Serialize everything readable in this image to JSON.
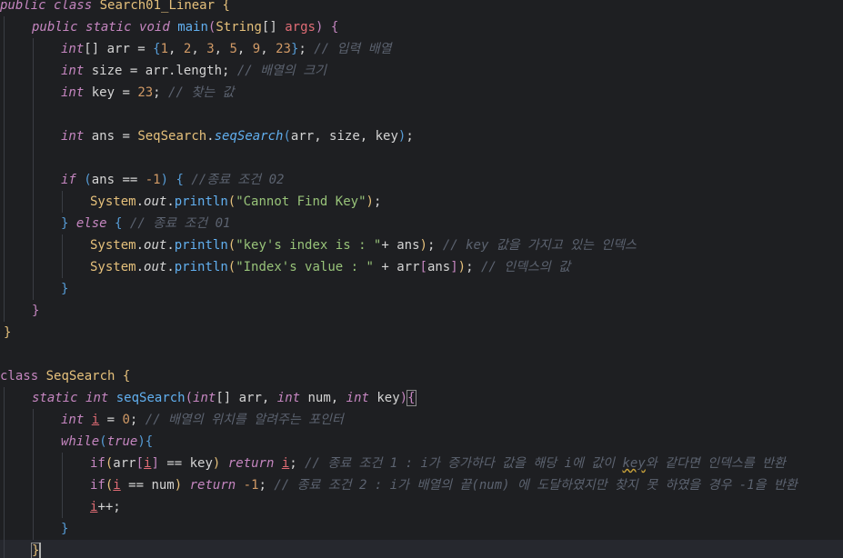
{
  "editor": {
    "lines": [
      {
        "segs": [
          [
            "kw",
            "public"
          ],
          [
            "plain",
            " "
          ],
          [
            "kw",
            "class"
          ],
          [
            "plain",
            " "
          ],
          [
            "cls",
            "Search01_Linear"
          ],
          [
            "plain",
            " "
          ],
          [
            "brace1",
            "{"
          ]
        ]
      },
      {
        "segs": [
          [
            "kw",
            "public"
          ],
          [
            "plain",
            " "
          ],
          [
            "kw",
            "static"
          ],
          [
            "plain",
            " "
          ],
          [
            "kw",
            "void"
          ],
          [
            "plain",
            " "
          ],
          [
            "fn",
            "main"
          ],
          [
            "brace2",
            "("
          ],
          [
            "cls",
            "String"
          ],
          [
            "plain",
            "[] "
          ],
          [
            "var",
            "args"
          ],
          [
            "brace2",
            ")"
          ],
          [
            "plain",
            " "
          ],
          [
            "brace2",
            "{"
          ]
        ]
      },
      {
        "segs": [
          [
            "type",
            "int"
          ],
          [
            "plain",
            "[] arr = "
          ],
          [
            "brace3",
            "{"
          ],
          [
            "num",
            "1"
          ],
          [
            "plain",
            ", "
          ],
          [
            "num",
            "2"
          ],
          [
            "plain",
            ", "
          ],
          [
            "num",
            "3"
          ],
          [
            "plain",
            ", "
          ],
          [
            "num",
            "5"
          ],
          [
            "plain",
            ", "
          ],
          [
            "num",
            "9"
          ],
          [
            "plain",
            ", "
          ],
          [
            "num",
            "23"
          ],
          [
            "brace3",
            "}"
          ],
          [
            "plain",
            "; "
          ],
          [
            "cmt",
            "// 입력 배열"
          ]
        ]
      },
      {
        "segs": [
          [
            "type",
            "int"
          ],
          [
            "plain",
            " size = arr.length; "
          ],
          [
            "cmt",
            "// 배열의 크기"
          ]
        ]
      },
      {
        "segs": [
          [
            "type",
            "int"
          ],
          [
            "plain",
            " key = "
          ],
          [
            "num",
            "23"
          ],
          [
            "plain",
            "; "
          ],
          [
            "cmt",
            "// 찾는 값"
          ]
        ]
      },
      {
        "segs": []
      },
      {
        "segs": [
          [
            "type",
            "int"
          ],
          [
            "plain",
            " ans = "
          ],
          [
            "cls",
            "SeqSearch"
          ],
          [
            "plain",
            "."
          ],
          [
            "fni",
            "seqSearch"
          ],
          [
            "brace3",
            "("
          ],
          [
            "plain",
            "arr, size, key"
          ],
          [
            "brace3",
            ")"
          ],
          [
            "plain",
            ";"
          ]
        ]
      },
      {
        "segs": []
      },
      {
        "segs": [
          [
            "kw",
            "if"
          ],
          [
            "plain",
            " "
          ],
          [
            "brace3",
            "("
          ],
          [
            "plain",
            "ans == "
          ],
          [
            "num",
            "-1"
          ],
          [
            "brace3",
            ")"
          ],
          [
            "plain",
            " "
          ],
          [
            "brace3",
            "{"
          ],
          [
            "plain",
            " "
          ],
          [
            "cmt",
            "//종료 조건 02"
          ]
        ]
      },
      {
        "segs": [
          [
            "cls",
            "System"
          ],
          [
            "plain",
            "."
          ],
          [
            "field",
            "out"
          ],
          [
            "plain",
            "."
          ],
          [
            "fn",
            "println"
          ],
          [
            "brace1",
            "("
          ],
          [
            "str",
            "\"Cannot Find Key\""
          ],
          [
            "brace1",
            ")"
          ],
          [
            "plain",
            ";"
          ]
        ]
      },
      {
        "segs": [
          [
            "brace3",
            "}"
          ],
          [
            "plain",
            " "
          ],
          [
            "kw",
            "else"
          ],
          [
            "plain",
            " "
          ],
          [
            "brace3",
            "{"
          ],
          [
            "plain",
            " "
          ],
          [
            "cmt",
            "// 종료 조건 01"
          ]
        ]
      },
      {
        "segs": [
          [
            "cls",
            "System"
          ],
          [
            "plain",
            "."
          ],
          [
            "field",
            "out"
          ],
          [
            "plain",
            "."
          ],
          [
            "fn",
            "println"
          ],
          [
            "brace1",
            "("
          ],
          [
            "str",
            "\"key's index is : \""
          ],
          [
            "plain",
            "+ ans"
          ],
          [
            "brace1",
            ")"
          ],
          [
            "plain",
            "; "
          ],
          [
            "cmt",
            "// key 값을 가지고 있는 인덱스"
          ]
        ]
      },
      {
        "segs": [
          [
            "cls",
            "System"
          ],
          [
            "plain",
            "."
          ],
          [
            "field",
            "out"
          ],
          [
            "plain",
            "."
          ],
          [
            "fn",
            "println"
          ],
          [
            "brace1",
            "("
          ],
          [
            "str",
            "\"Index's value : \""
          ],
          [
            "plain",
            " + arr"
          ],
          [
            "brace2",
            "["
          ],
          [
            "plain",
            "ans"
          ],
          [
            "brace2",
            "]"
          ],
          [
            "brace1",
            ")"
          ],
          [
            "plain",
            "; "
          ],
          [
            "cmt",
            "// 인덱스의 값"
          ]
        ]
      },
      {
        "segs": [
          [
            "brace3",
            "}"
          ]
        ]
      },
      {
        "segs": [
          [
            "brace2",
            "}"
          ]
        ]
      },
      {
        "segs": [
          [
            "brace1",
            "}"
          ]
        ]
      },
      {
        "segs": []
      },
      {
        "segs": [
          [
            "kw2",
            "class"
          ],
          [
            "plain",
            " "
          ],
          [
            "cls",
            "SeqSearch"
          ],
          [
            "plain",
            " "
          ],
          [
            "brace1",
            "{"
          ]
        ]
      },
      {
        "segs": [
          [
            "kw",
            "static"
          ],
          [
            "plain",
            " "
          ],
          [
            "type",
            "int"
          ],
          [
            "plain",
            " "
          ],
          [
            "fn",
            "seqSearch"
          ],
          [
            "brace2",
            "("
          ],
          [
            "type",
            "int"
          ],
          [
            "plain",
            "[] arr, "
          ],
          [
            "type",
            "int"
          ],
          [
            "plain",
            " num, "
          ],
          [
            "type",
            "int"
          ],
          [
            "plain",
            " key"
          ],
          [
            "brace2",
            ")"
          ],
          [
            "brace2cursor",
            "{"
          ]
        ]
      },
      {
        "segs": [
          [
            "type",
            "int"
          ],
          [
            "plain",
            " "
          ],
          [
            "varul",
            "i"
          ],
          [
            "plain",
            " = "
          ],
          [
            "num",
            "0"
          ],
          [
            "plain",
            "; "
          ],
          [
            "cmt",
            "// 배열의 위치를 알려주는 포인터"
          ]
        ]
      },
      {
        "segs": [
          [
            "kw",
            "while"
          ],
          [
            "brace3",
            "("
          ],
          [
            "kw",
            "true"
          ],
          [
            "brace3",
            ")"
          ],
          [
            "brace3",
            "{"
          ]
        ]
      },
      {
        "segs": [
          [
            "kw2",
            "if"
          ],
          [
            "brace1",
            "("
          ],
          [
            "plain",
            "arr"
          ],
          [
            "brace2",
            "["
          ],
          [
            "varul",
            "i"
          ],
          [
            "brace2",
            "]"
          ],
          [
            "plain",
            " == key"
          ],
          [
            "brace1",
            ")"
          ],
          [
            "plain",
            " "
          ],
          [
            "kw",
            "return"
          ],
          [
            "plain",
            " "
          ],
          [
            "varul",
            "i"
          ],
          [
            "plain",
            "; "
          ],
          [
            "cmt",
            "// 종료 조건 1 : i가 증가하다 값을 해당 i에 값이 "
          ],
          [
            "cmtsq",
            "key"
          ],
          [
            "cmt",
            "와 같다면 인덱스를 반환"
          ]
        ]
      },
      {
        "segs": [
          [
            "kw2",
            "if"
          ],
          [
            "brace1",
            "("
          ],
          [
            "varul",
            "i"
          ],
          [
            "plain",
            " == num"
          ],
          [
            "brace1",
            ")"
          ],
          [
            "plain",
            " "
          ],
          [
            "kw",
            "return"
          ],
          [
            "plain",
            " "
          ],
          [
            "num",
            "-1"
          ],
          [
            "plain",
            "; "
          ],
          [
            "cmt",
            "// 종료 조건 2 : i가 배열의 끝(num) 에 도달하였지만 찾지 못 하였을 경우 -1을 반환"
          ]
        ]
      },
      {
        "segs": [
          [
            "varul",
            "i"
          ],
          [
            "plain",
            "++;"
          ]
        ]
      },
      {
        "segs": [
          [
            "brace3",
            "}"
          ]
        ]
      },
      {
        "segs": [
          [
            "brace2cursor2",
            "}"
          ]
        ]
      }
    ]
  },
  "colors": {
    "background": "#1e1f22",
    "keyword": "#c586c0",
    "class": "#e5c07b",
    "function": "#61afef",
    "number": "#d19a66",
    "string": "#98c379",
    "comment": "#5c6370"
  }
}
